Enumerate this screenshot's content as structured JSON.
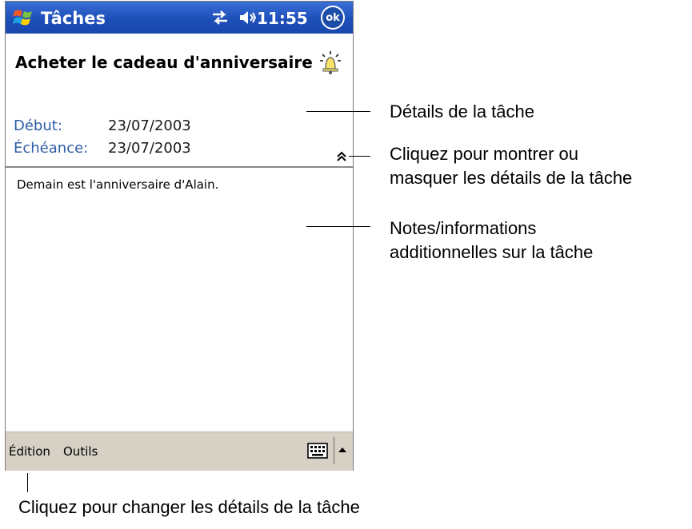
{
  "titlebar": {
    "app_title": "Tâches",
    "clock": "11:55",
    "ok_label": "ok"
  },
  "task": {
    "subject": "Acheter le cadeau d'anniversaire",
    "start_label": "Début:",
    "start_value": "23/07/2003",
    "due_label": "Échéance:",
    "due_value": "23/07/2003",
    "notes": "Demain est l'anniversaire d'Alain."
  },
  "menubar": {
    "edit": "Édition",
    "tools": "Outils"
  },
  "callouts": {
    "details": "Détails de la tâche",
    "toggle_line1": "Cliquez pour montrer ou",
    "toggle_line2": "masquer les détails de la tâche",
    "notes_line1": "Notes/informations",
    "notes_line2": "additionnelles sur la tâche",
    "menu": "Cliquez pour changer les détails de la tâche"
  },
  "icons": {
    "start": "windows-flag-icon",
    "connection": "connection-arrows-icon",
    "volume": "speaker-icon",
    "reminder": "alarm-bell-icon",
    "toggle": "double-chevron-up-icon",
    "keyboard": "keyboard-icon",
    "sip": "triangle-up-icon"
  },
  "colors": {
    "titlebar": "#1d4fb8",
    "label_blue": "#2d5ca6",
    "menubar": "#d6d0c5"
  }
}
